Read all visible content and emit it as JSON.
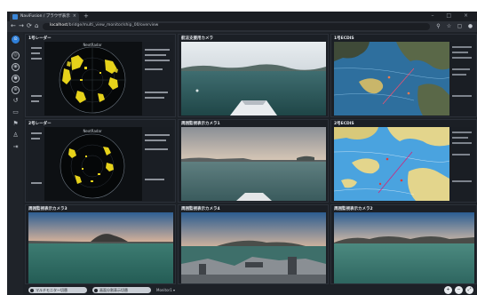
{
  "browser": {
    "tab_title": "NaviFusion / ブラウザ表示",
    "tab_close": "×",
    "new_tab": "+",
    "window_controls": "– □ ×",
    "nav_back": "←",
    "nav_forward": "→",
    "nav_reload": "⟳",
    "nav_home": "⌂",
    "url_host": "localhost",
    "url_path": "/bridge/multi_view_monitor/ship_00/overview"
  },
  "sidebar": {
    "items": [
      {
        "name": "home",
        "glyph": "⊙"
      },
      {
        "name": "radar",
        "glyph": "◎"
      },
      {
        "name": "ecdis",
        "glyph": "◉"
      },
      {
        "name": "camera",
        "glyph": "●"
      },
      {
        "name": "settings",
        "glyph": "⊕"
      },
      {
        "name": "back",
        "glyph": "↺"
      },
      {
        "name": "layout",
        "glyph": "▭"
      },
      {
        "name": "alert",
        "glyph": "⚑"
      },
      {
        "name": "user",
        "glyph": "♙"
      },
      {
        "name": "export",
        "glyph": "⇥"
      }
    ]
  },
  "panels": {
    "p1": {
      "label": "1号レーダー",
      "brand": "NextRadar"
    },
    "p2": {
      "label": "航法支援用カメラ"
    },
    "p3": {
      "label": "1号ECDIS"
    },
    "p4": {
      "label": "2号レーダー",
      "brand": "NextRadar"
    },
    "p5": {
      "label": "周囲監視表示カメラ1"
    },
    "p6": {
      "label": "2号ECDIS"
    },
    "p7": {
      "label": "周囲監視表示カメラ3"
    },
    "p8": {
      "label": "周囲監視表示カメラ4"
    },
    "p9": {
      "label": "周囲監視表示カメラ2"
    }
  },
  "bottombar": {
    "pill1": "マルチモニター切替",
    "pill2": "画面分割表示切替",
    "select": "Monitor1 ▾",
    "buttons": [
      "+",
      "−",
      "⤢"
    ]
  },
  "colors": {
    "accent": "#2f7fd8",
    "frame_bg": "#1d2127",
    "radar_echo": "#e6d21a",
    "sea": "#2a6a6e",
    "chart_water": "#3a8cc8"
  }
}
